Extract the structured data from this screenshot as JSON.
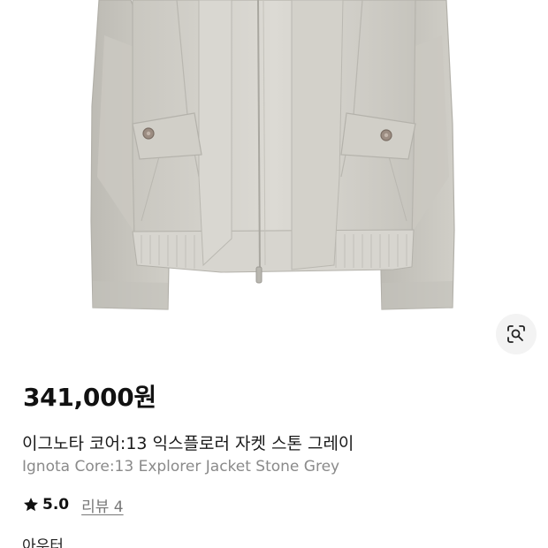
{
  "product": {
    "price": "341,000원",
    "title_ko": "이그노타 코어:13 익스플로러 자켓 스톤 그레이",
    "title_en": "Ignota Core:13 Explorer Jacket Stone Grey",
    "rating": "5.0",
    "review_label": "리뷰 4",
    "category": "아우터"
  },
  "icons": {
    "lens": "visual-search-icon",
    "star": "star-icon"
  },
  "colors": {
    "jacket": "#d6d4cd",
    "text_primary": "#111111",
    "text_secondary": "#8a8a8a",
    "lens_button_bg": "#f3f3f3"
  }
}
